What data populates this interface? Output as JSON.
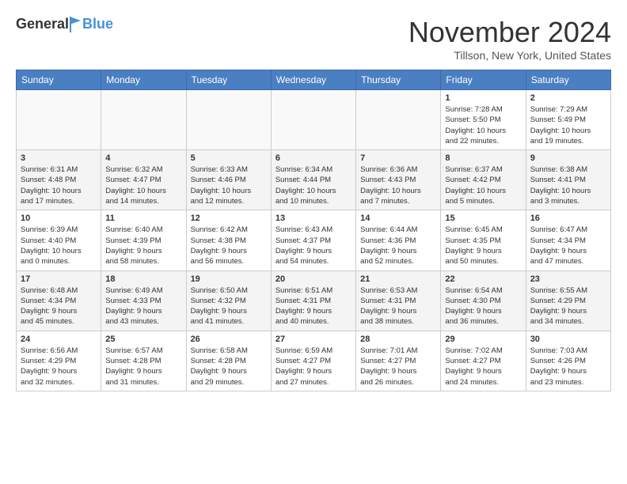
{
  "header": {
    "logo_general": "General",
    "logo_blue": "Blue",
    "month_title": "November 2024",
    "location": "Tillson, New York, United States"
  },
  "calendar": {
    "days_of_week": [
      "Sunday",
      "Monday",
      "Tuesday",
      "Wednesday",
      "Thursday",
      "Friday",
      "Saturday"
    ],
    "weeks": [
      [
        {
          "day": "",
          "info": ""
        },
        {
          "day": "",
          "info": ""
        },
        {
          "day": "",
          "info": ""
        },
        {
          "day": "",
          "info": ""
        },
        {
          "day": "",
          "info": ""
        },
        {
          "day": "1",
          "info": "Sunrise: 7:28 AM\nSunset: 5:50 PM\nDaylight: 10 hours\nand 22 minutes."
        },
        {
          "day": "2",
          "info": "Sunrise: 7:29 AM\nSunset: 5:49 PM\nDaylight: 10 hours\nand 19 minutes."
        }
      ],
      [
        {
          "day": "3",
          "info": "Sunrise: 6:31 AM\nSunset: 4:48 PM\nDaylight: 10 hours\nand 17 minutes."
        },
        {
          "day": "4",
          "info": "Sunrise: 6:32 AM\nSunset: 4:47 PM\nDaylight: 10 hours\nand 14 minutes."
        },
        {
          "day": "5",
          "info": "Sunrise: 6:33 AM\nSunset: 4:46 PM\nDaylight: 10 hours\nand 12 minutes."
        },
        {
          "day": "6",
          "info": "Sunrise: 6:34 AM\nSunset: 4:44 PM\nDaylight: 10 hours\nand 10 minutes."
        },
        {
          "day": "7",
          "info": "Sunrise: 6:36 AM\nSunset: 4:43 PM\nDaylight: 10 hours\nand 7 minutes."
        },
        {
          "day": "8",
          "info": "Sunrise: 6:37 AM\nSunset: 4:42 PM\nDaylight: 10 hours\nand 5 minutes."
        },
        {
          "day": "9",
          "info": "Sunrise: 6:38 AM\nSunset: 4:41 PM\nDaylight: 10 hours\nand 3 minutes."
        }
      ],
      [
        {
          "day": "10",
          "info": "Sunrise: 6:39 AM\nSunset: 4:40 PM\nDaylight: 10 hours\nand 0 minutes."
        },
        {
          "day": "11",
          "info": "Sunrise: 6:40 AM\nSunset: 4:39 PM\nDaylight: 9 hours\nand 58 minutes."
        },
        {
          "day": "12",
          "info": "Sunrise: 6:42 AM\nSunset: 4:38 PM\nDaylight: 9 hours\nand 56 minutes."
        },
        {
          "day": "13",
          "info": "Sunrise: 6:43 AM\nSunset: 4:37 PM\nDaylight: 9 hours\nand 54 minutes."
        },
        {
          "day": "14",
          "info": "Sunrise: 6:44 AM\nSunset: 4:36 PM\nDaylight: 9 hours\nand 52 minutes."
        },
        {
          "day": "15",
          "info": "Sunrise: 6:45 AM\nSunset: 4:35 PM\nDaylight: 9 hours\nand 50 minutes."
        },
        {
          "day": "16",
          "info": "Sunrise: 6:47 AM\nSunset: 4:34 PM\nDaylight: 9 hours\nand 47 minutes."
        }
      ],
      [
        {
          "day": "17",
          "info": "Sunrise: 6:48 AM\nSunset: 4:34 PM\nDaylight: 9 hours\nand 45 minutes."
        },
        {
          "day": "18",
          "info": "Sunrise: 6:49 AM\nSunset: 4:33 PM\nDaylight: 9 hours\nand 43 minutes."
        },
        {
          "day": "19",
          "info": "Sunrise: 6:50 AM\nSunset: 4:32 PM\nDaylight: 9 hours\nand 41 minutes."
        },
        {
          "day": "20",
          "info": "Sunrise: 6:51 AM\nSunset: 4:31 PM\nDaylight: 9 hours\nand 40 minutes."
        },
        {
          "day": "21",
          "info": "Sunrise: 6:53 AM\nSunset: 4:31 PM\nDaylight: 9 hours\nand 38 minutes."
        },
        {
          "day": "22",
          "info": "Sunrise: 6:54 AM\nSunset: 4:30 PM\nDaylight: 9 hours\nand 36 minutes."
        },
        {
          "day": "23",
          "info": "Sunrise: 6:55 AM\nSunset: 4:29 PM\nDaylight: 9 hours\nand 34 minutes."
        }
      ],
      [
        {
          "day": "24",
          "info": "Sunrise: 6:56 AM\nSunset: 4:29 PM\nDaylight: 9 hours\nand 32 minutes."
        },
        {
          "day": "25",
          "info": "Sunrise: 6:57 AM\nSunset: 4:28 PM\nDaylight: 9 hours\nand 31 minutes."
        },
        {
          "day": "26",
          "info": "Sunrise: 6:58 AM\nSunset: 4:28 PM\nDaylight: 9 hours\nand 29 minutes."
        },
        {
          "day": "27",
          "info": "Sunrise: 6:59 AM\nSunset: 4:27 PM\nDaylight: 9 hours\nand 27 minutes."
        },
        {
          "day": "28",
          "info": "Sunrise: 7:01 AM\nSunset: 4:27 PM\nDaylight: 9 hours\nand 26 minutes."
        },
        {
          "day": "29",
          "info": "Sunrise: 7:02 AM\nSunset: 4:27 PM\nDaylight: 9 hours\nand 24 minutes."
        },
        {
          "day": "30",
          "info": "Sunrise: 7:03 AM\nSunset: 4:26 PM\nDaylight: 9 hours\nand 23 minutes."
        }
      ]
    ]
  }
}
